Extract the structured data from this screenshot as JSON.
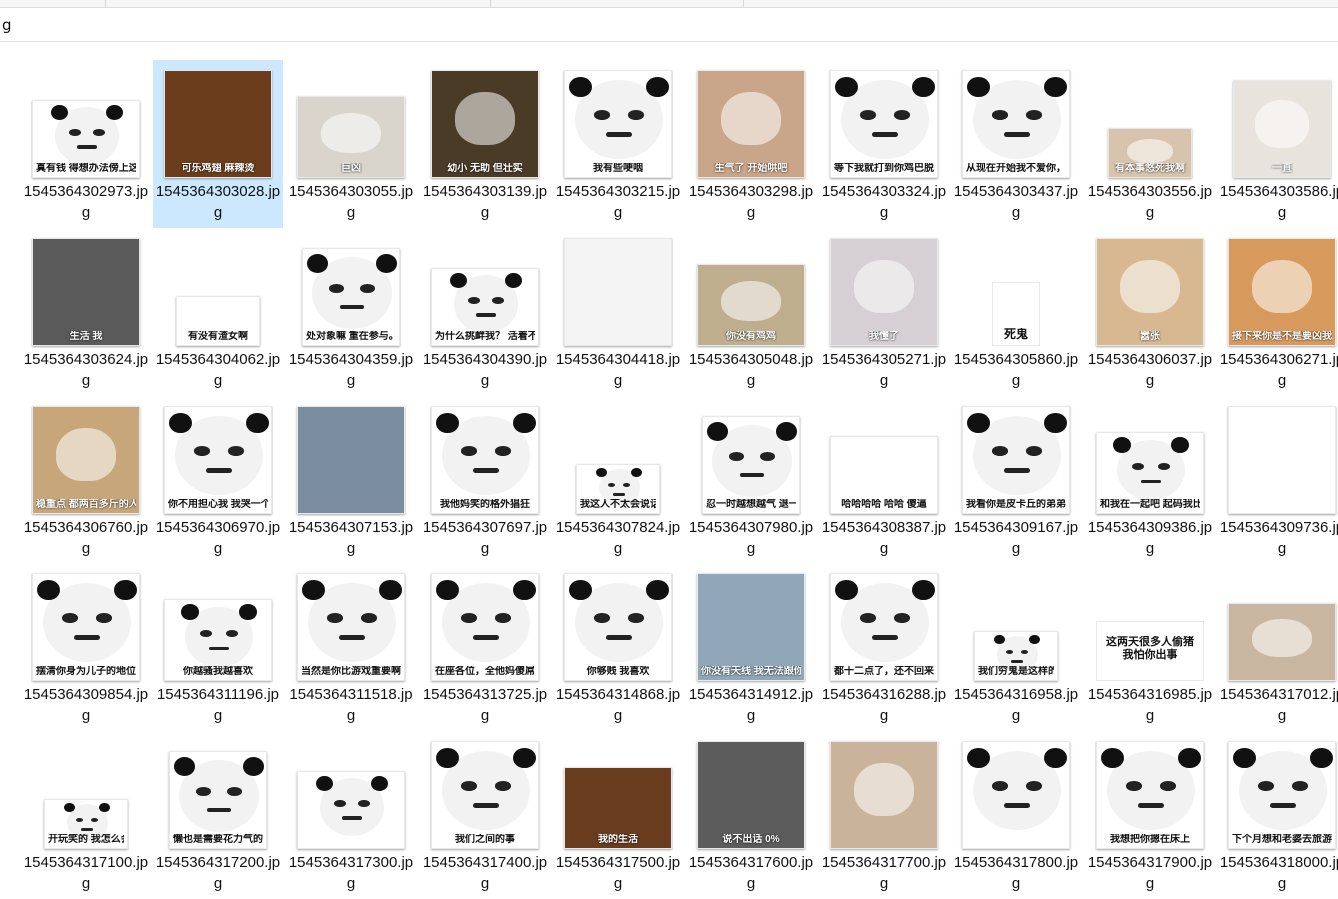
{
  "path": {
    "text": "g"
  },
  "files": [
    {
      "name": "1545364302973.jpg",
      "caption": "真有钱 得想办法傍上这个富婆",
      "bg": "#ffffff",
      "kind": "panda"
    },
    {
      "name": "1545364303028.jpg",
      "caption": "可乐鸡翅 麻辣烫",
      "bg": "#6b3d1c",
      "kind": "food",
      "selected": true
    },
    {
      "name": "1545364303055.jpg",
      "caption": "巨凶",
      "bg": "#d9d4cc",
      "kind": "cat"
    },
    {
      "name": "1545364303139.jpg",
      "caption": "幼小 无助 但壮实",
      "bg": "#4a3b27",
      "kind": "cat"
    },
    {
      "name": "1545364303215.jpg",
      "caption": "我有些哽咽",
      "bg": "#ffffff",
      "kind": "panda"
    },
    {
      "name": "1545364303298.jpg",
      "caption": "生气了 开始哄吧",
      "bg": "#c9a58a",
      "kind": "cat"
    },
    {
      "name": "1545364303324.jpg",
      "caption": "等下我就打到你鸡巴脱臼",
      "bg": "#ffffff",
      "kind": "panda"
    },
    {
      "name": "1545364303437.jpg",
      "caption": "从现在开始我不爱你，听见没有，不爱你了",
      "bg": "#ffffff",
      "kind": "panda"
    },
    {
      "name": "1545364303556.jpg",
      "caption": "有本事悠死我啊",
      "bg": "#d8c3ad",
      "kind": "cat"
    },
    {
      "name": "1545364303586.jpg",
      "caption": "一直",
      "bg": "#e9e3de",
      "kind": "cat"
    },
    {
      "name": "1545364303624.jpg",
      "caption": "生活 我",
      "bg": "#5a5a5a",
      "kind": "photo"
    },
    {
      "name": "1545364304062.jpg",
      "caption": "有没有渣女啊",
      "bg": "#ffffff",
      "kind": "text"
    },
    {
      "name": "1545364304359.jpg",
      "caption": "处对象嘛 重在参与。",
      "bg": "#ffffff",
      "kind": "panda"
    },
    {
      "name": "1545364304390.jpg",
      "caption": "为什么挑衅我？ 活着不好吗？",
      "bg": "#ffffff",
      "kind": "panda"
    },
    {
      "name": "1545364304418.jpg",
      "caption": "",
      "bg": "#f4f4f4",
      "kind": "comic"
    },
    {
      "name": "1545364305048.jpg",
      "caption": "你没有鸡鸡",
      "bg": "#bfae8e",
      "kind": "cat"
    },
    {
      "name": "1545364305271.jpg",
      "caption": "我懂了",
      "bg": "#d6cfd3",
      "kind": "cat"
    },
    {
      "name": "1545364305860.jpg",
      "caption": "死鬼",
      "bg": "#ffffff",
      "kind": "small"
    },
    {
      "name": "1545364306037.jpg",
      "caption": "嚣张",
      "bg": "#d8b890",
      "kind": "cat"
    },
    {
      "name": "1545364306271.jpg",
      "caption": "接下来你是不是要凶我了",
      "bg": "#d89a5c",
      "kind": "cat"
    },
    {
      "name": "1545364306760.jpg",
      "caption": "稳重点 都两百多斤的人了",
      "bg": "#c7a67a",
      "kind": "cat"
    },
    {
      "name": "1545364306970.jpg",
      "caption": "你不用担心我 我哭一个月就会没事了",
      "bg": "#ffffff",
      "kind": "panda"
    },
    {
      "name": "1545364307153.jpg",
      "caption": "",
      "bg": "#7a8ea0",
      "kind": "photo"
    },
    {
      "name": "1545364307697.jpg",
      "caption": "我他妈笑的格外猖狂",
      "bg": "#ffffff",
      "kind": "panda"
    },
    {
      "name": "1545364307824.jpg",
      "caption": "我这人不太会说话 要是有什么得罪的地方",
      "bg": "#ffffff",
      "kind": "panda"
    },
    {
      "name": "1545364307980.jpg",
      "caption": "忍一时越想越气 退一步越想越亏",
      "bg": "#ffffff",
      "kind": "panda"
    },
    {
      "name": "1545364308387.jpg",
      "caption": "哈哈哈哈 哈哈 傻逼",
      "bg": "#ffffff",
      "kind": "comic"
    },
    {
      "name": "1545364309167.jpg",
      "caption": "我看你是皮卡丘的弟弟 皮在痒吧",
      "bg": "#ffffff",
      "kind": "panda"
    },
    {
      "name": "1545364309386.jpg",
      "caption": "和我在一起吧 起码我比别人多了十几斤肉在爱你",
      "bg": "#ffffff",
      "kind": "panda"
    },
    {
      "name": "1545364309736.jpg",
      "caption": "",
      "bg": "#ffffff",
      "kind": "comic"
    },
    {
      "name": "1545364309854.jpg",
      "caption": "摆清你身为儿子的地位",
      "bg": "#ffffff",
      "kind": "panda"
    },
    {
      "name": "1545364311196.jpg",
      "caption": "你越骚我越喜欢",
      "bg": "#ffffff",
      "kind": "panda"
    },
    {
      "name": "1545364311518.jpg",
      "caption": "当然是你比游戏重要啊",
      "bg": "#ffffff",
      "kind": "panda"
    },
    {
      "name": "1545364313725.jpg",
      "caption": "在座各位，全他妈傻屌！",
      "bg": "#ffffff",
      "kind": "panda"
    },
    {
      "name": "1545364314868.jpg",
      "caption": "你够贱 我喜欢",
      "bg": "#ffffff",
      "kind": "panda"
    },
    {
      "name": "1545364314912.jpg",
      "caption": "你没有天线 我无法跟你沟通",
      "bg": "#8fa7b8",
      "kind": "photo"
    },
    {
      "name": "1545364316288.jpg",
      "caption": "都十二点了，还不回来",
      "bg": "#ffffff",
      "kind": "panda"
    },
    {
      "name": "1545364316958.jpg",
      "caption": "我们穷鬼是这样的啦",
      "bg": "#ffffff",
      "kind": "panda"
    },
    {
      "name": "1545364316985.jpg",
      "caption": "这两天很多人偷猪 我怕你出事",
      "bg": "#ffffff",
      "kind": "textonly"
    },
    {
      "name": "1545364317012.jpg",
      "caption": "",
      "bg": "#c9b6a0",
      "kind": "cat"
    },
    {
      "name": "1545364317100.jpg",
      "caption": "开玩笑的 我怎么会骂你",
      "bg": "#ffffff",
      "kind": "panda"
    },
    {
      "name": "1545364317200.jpg",
      "caption": "懒也是需要花力气的",
      "bg": "#ffffff",
      "kind": "panda"
    },
    {
      "name": "1545364317300.jpg",
      "caption": "",
      "bg": "#ffffff",
      "kind": "panda"
    },
    {
      "name": "1545364317400.jpg",
      "caption": "我们之间的事",
      "bg": "#ffffff",
      "kind": "panda"
    },
    {
      "name": "1545364317500.jpg",
      "caption": "我的生活",
      "bg": "#6a3c1e",
      "kind": "photo"
    },
    {
      "name": "1545364317600.jpg",
      "caption": "说不出话 0%",
      "bg": "#5c5c5c",
      "kind": "photo"
    },
    {
      "name": "1545364317700.jpg",
      "caption": "",
      "bg": "#c9b39b",
      "kind": "cat"
    },
    {
      "name": "1545364317800.jpg",
      "caption": "",
      "bg": "#ffffff",
      "kind": "panda"
    },
    {
      "name": "1545364317900.jpg",
      "caption": "我想把你摁在床上",
      "bg": "#ffffff",
      "kind": "panda"
    },
    {
      "name": "1545364318000.jpg",
      "caption": "下个月想和老婆去旅游",
      "bg": "#ffffff",
      "kind": "panda"
    }
  ]
}
